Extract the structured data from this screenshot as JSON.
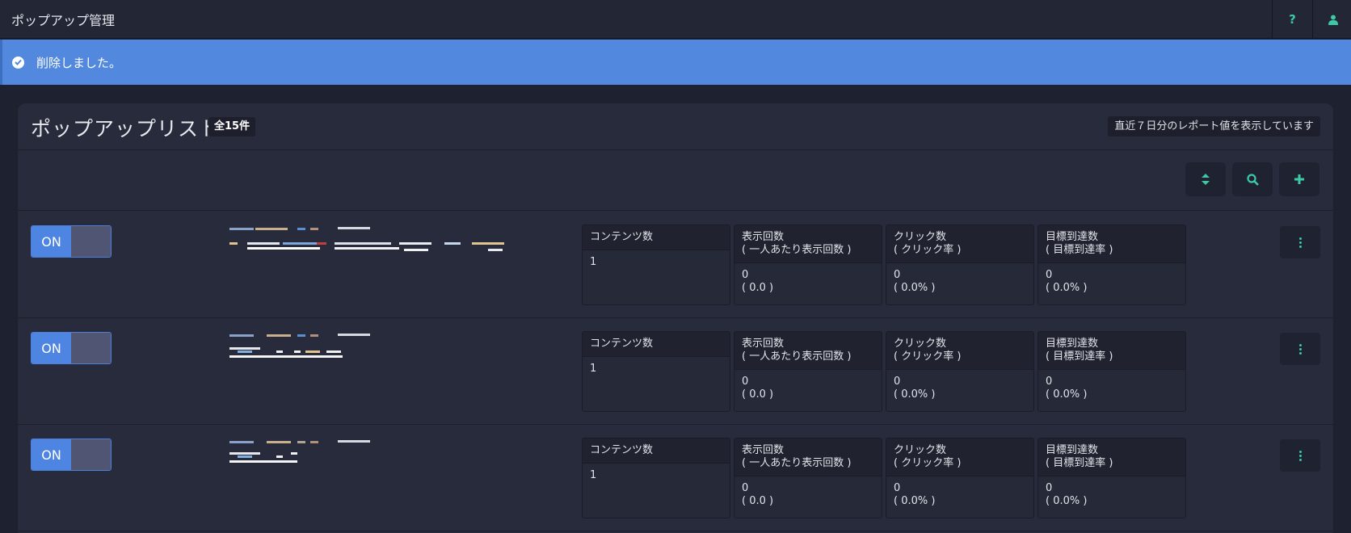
{
  "header": {
    "title": "ポップアップ管理",
    "help_icon": "question-icon",
    "user_icon": "user-icon"
  },
  "alert": {
    "icon": "check-circle-icon",
    "message": "削除しました。"
  },
  "panel": {
    "title": "ポップアップリスト",
    "count": "全15件",
    "note": "直近７日分のレポート値を表示しています",
    "toolbar": {
      "sort_icon": "sort-icon",
      "search_icon": "search-icon",
      "add_icon": "plus-icon"
    }
  },
  "colors": {
    "accent": "#3ec9a5",
    "toggle_on": "#4f85e2",
    "alert_bg": "#5289de"
  },
  "rows": [
    {
      "toggle": "ON",
      "contents": {
        "label": "コンテンツ数",
        "value": "1"
      },
      "views": {
        "label1": "表示回数",
        "label2": "( 一人あたり表示回数 )",
        "value": "0",
        "sub": "( 0.0 )"
      },
      "clicks": {
        "label1": "クリック数",
        "label2": "( クリック率 )",
        "value": "0",
        "sub": "( 0.0% )"
      },
      "goals": {
        "label1": "目標到達数",
        "label2": "( 目標到達率 )",
        "value": "0",
        "sub": "( 0.0% )"
      }
    },
    {
      "toggle": "ON",
      "contents": {
        "label": "コンテンツ数",
        "value": "1"
      },
      "views": {
        "label1": "表示回数",
        "label2": "( 一人あたり表示回数 )",
        "value": "0",
        "sub": "( 0.0 )"
      },
      "clicks": {
        "label1": "クリック数",
        "label2": "( クリック率 )",
        "value": "0",
        "sub": "( 0.0% )"
      },
      "goals": {
        "label1": "目標到達数",
        "label2": "( 目標到達率 )",
        "value": "0",
        "sub": "( 0.0% )"
      }
    },
    {
      "toggle": "ON",
      "contents": {
        "label": "コンテンツ数",
        "value": "1"
      },
      "views": {
        "label1": "表示回数",
        "label2": "( 一人あたり表示回数 )",
        "value": "0",
        "sub": "( 0.0 )"
      },
      "clicks": {
        "label1": "クリック数",
        "label2": "( クリック率 )",
        "value": "0",
        "sub": "( 0.0% )"
      },
      "goals": {
        "label1": "目標到達数",
        "label2": "( 目標到達率 )",
        "value": "0",
        "sub": "( 0.0% )"
      }
    }
  ]
}
